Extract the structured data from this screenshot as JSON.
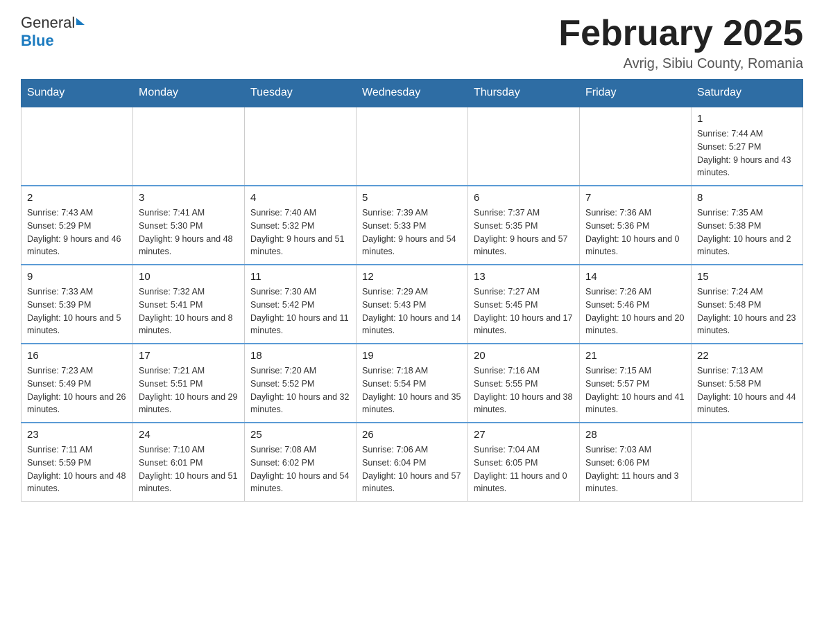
{
  "header": {
    "logo_general": "General",
    "logo_blue": "Blue",
    "month_title": "February 2025",
    "location": "Avrig, Sibiu County, Romania"
  },
  "days_of_week": [
    "Sunday",
    "Monday",
    "Tuesday",
    "Wednesday",
    "Thursday",
    "Friday",
    "Saturday"
  ],
  "weeks": [
    [
      {
        "day": "",
        "info": ""
      },
      {
        "day": "",
        "info": ""
      },
      {
        "day": "",
        "info": ""
      },
      {
        "day": "",
        "info": ""
      },
      {
        "day": "",
        "info": ""
      },
      {
        "day": "",
        "info": ""
      },
      {
        "day": "1",
        "info": "Sunrise: 7:44 AM\nSunset: 5:27 PM\nDaylight: 9 hours and 43 minutes."
      }
    ],
    [
      {
        "day": "2",
        "info": "Sunrise: 7:43 AM\nSunset: 5:29 PM\nDaylight: 9 hours and 46 minutes."
      },
      {
        "day": "3",
        "info": "Sunrise: 7:41 AM\nSunset: 5:30 PM\nDaylight: 9 hours and 48 minutes."
      },
      {
        "day": "4",
        "info": "Sunrise: 7:40 AM\nSunset: 5:32 PM\nDaylight: 9 hours and 51 minutes."
      },
      {
        "day": "5",
        "info": "Sunrise: 7:39 AM\nSunset: 5:33 PM\nDaylight: 9 hours and 54 minutes."
      },
      {
        "day": "6",
        "info": "Sunrise: 7:37 AM\nSunset: 5:35 PM\nDaylight: 9 hours and 57 minutes."
      },
      {
        "day": "7",
        "info": "Sunrise: 7:36 AM\nSunset: 5:36 PM\nDaylight: 10 hours and 0 minutes."
      },
      {
        "day": "8",
        "info": "Sunrise: 7:35 AM\nSunset: 5:38 PM\nDaylight: 10 hours and 2 minutes."
      }
    ],
    [
      {
        "day": "9",
        "info": "Sunrise: 7:33 AM\nSunset: 5:39 PM\nDaylight: 10 hours and 5 minutes."
      },
      {
        "day": "10",
        "info": "Sunrise: 7:32 AM\nSunset: 5:41 PM\nDaylight: 10 hours and 8 minutes."
      },
      {
        "day": "11",
        "info": "Sunrise: 7:30 AM\nSunset: 5:42 PM\nDaylight: 10 hours and 11 minutes."
      },
      {
        "day": "12",
        "info": "Sunrise: 7:29 AM\nSunset: 5:43 PM\nDaylight: 10 hours and 14 minutes."
      },
      {
        "day": "13",
        "info": "Sunrise: 7:27 AM\nSunset: 5:45 PM\nDaylight: 10 hours and 17 minutes."
      },
      {
        "day": "14",
        "info": "Sunrise: 7:26 AM\nSunset: 5:46 PM\nDaylight: 10 hours and 20 minutes."
      },
      {
        "day": "15",
        "info": "Sunrise: 7:24 AM\nSunset: 5:48 PM\nDaylight: 10 hours and 23 minutes."
      }
    ],
    [
      {
        "day": "16",
        "info": "Sunrise: 7:23 AM\nSunset: 5:49 PM\nDaylight: 10 hours and 26 minutes."
      },
      {
        "day": "17",
        "info": "Sunrise: 7:21 AM\nSunset: 5:51 PM\nDaylight: 10 hours and 29 minutes."
      },
      {
        "day": "18",
        "info": "Sunrise: 7:20 AM\nSunset: 5:52 PM\nDaylight: 10 hours and 32 minutes."
      },
      {
        "day": "19",
        "info": "Sunrise: 7:18 AM\nSunset: 5:54 PM\nDaylight: 10 hours and 35 minutes."
      },
      {
        "day": "20",
        "info": "Sunrise: 7:16 AM\nSunset: 5:55 PM\nDaylight: 10 hours and 38 minutes."
      },
      {
        "day": "21",
        "info": "Sunrise: 7:15 AM\nSunset: 5:57 PM\nDaylight: 10 hours and 41 minutes."
      },
      {
        "day": "22",
        "info": "Sunrise: 7:13 AM\nSunset: 5:58 PM\nDaylight: 10 hours and 44 minutes."
      }
    ],
    [
      {
        "day": "23",
        "info": "Sunrise: 7:11 AM\nSunset: 5:59 PM\nDaylight: 10 hours and 48 minutes."
      },
      {
        "day": "24",
        "info": "Sunrise: 7:10 AM\nSunset: 6:01 PM\nDaylight: 10 hours and 51 minutes."
      },
      {
        "day": "25",
        "info": "Sunrise: 7:08 AM\nSunset: 6:02 PM\nDaylight: 10 hours and 54 minutes."
      },
      {
        "day": "26",
        "info": "Sunrise: 7:06 AM\nSunset: 6:04 PM\nDaylight: 10 hours and 57 minutes."
      },
      {
        "day": "27",
        "info": "Sunrise: 7:04 AM\nSunset: 6:05 PM\nDaylight: 11 hours and 0 minutes."
      },
      {
        "day": "28",
        "info": "Sunrise: 7:03 AM\nSunset: 6:06 PM\nDaylight: 11 hours and 3 minutes."
      },
      {
        "day": "",
        "info": ""
      }
    ]
  ]
}
